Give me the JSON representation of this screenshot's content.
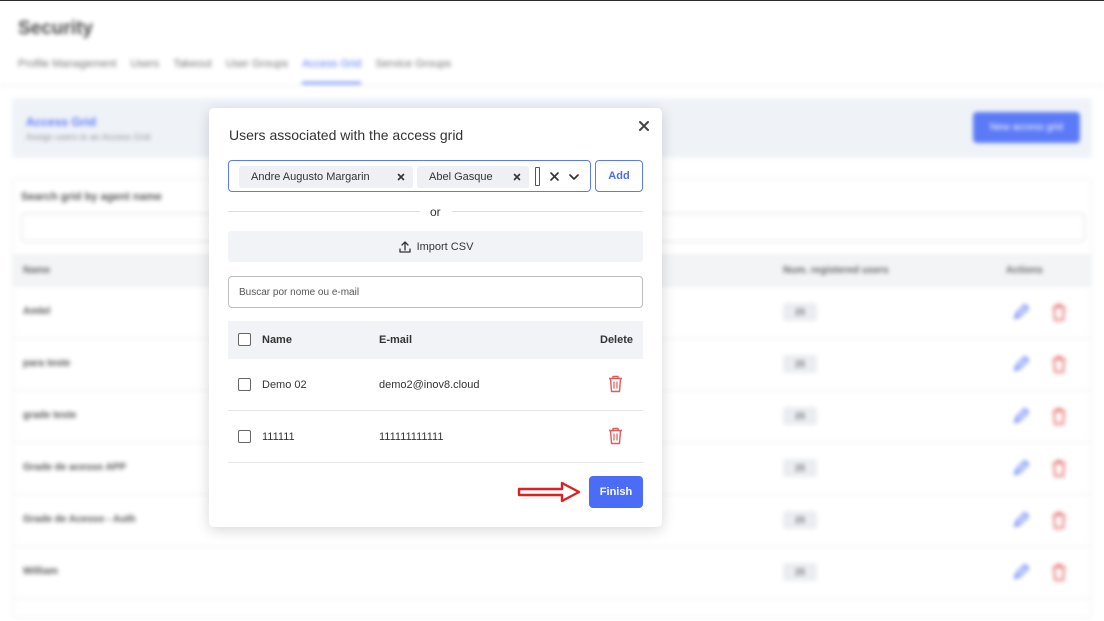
{
  "background": {
    "page_title": "Security",
    "tabs": [
      "Profile Management",
      "Users",
      "Takeout",
      "User Groups",
      "Access Grid",
      "Service Groups"
    ],
    "active_tab": "Access Grid",
    "banner": {
      "title": "Access Grid",
      "subtitle": "Assign users to an Access Grid",
      "new_button": "New access grid"
    },
    "search_label": "Search grid by agent name",
    "table_headers": {
      "name": "Name",
      "registered": "Num. registered users",
      "actions": "Actions"
    },
    "rows": [
      {
        "name": "Amlel",
        "count": "25"
      },
      {
        "name": "para teste",
        "count": "25"
      },
      {
        "name": "grade teste",
        "count": "25"
      },
      {
        "name": "Grade de acesso APP",
        "count": "25"
      },
      {
        "name": "Grade de Acesso - Auth",
        "count": "25"
      },
      {
        "name": "William",
        "count": "25"
      }
    ]
  },
  "modal": {
    "title": "Users associated with the access grid",
    "selected_users": [
      "Andre Augusto Margarin",
      "Abel Gasque"
    ],
    "add_label": "Add",
    "or_label": "or",
    "import_label": "Import CSV",
    "search_placeholder": "Buscar por nome ou e-mail",
    "columns": {
      "name": "Name",
      "email": "E-mail",
      "delete": "Delete"
    },
    "users": [
      {
        "name": "Demo 02",
        "email": "demo2@inov8.cloud"
      },
      {
        "name": "111111",
        "email": "111111111111"
      }
    ],
    "finish_label": "Finish"
  },
  "colors": {
    "accent": "#4a6cf7",
    "danger": "#e45a5a",
    "arrow": "#e02020"
  }
}
